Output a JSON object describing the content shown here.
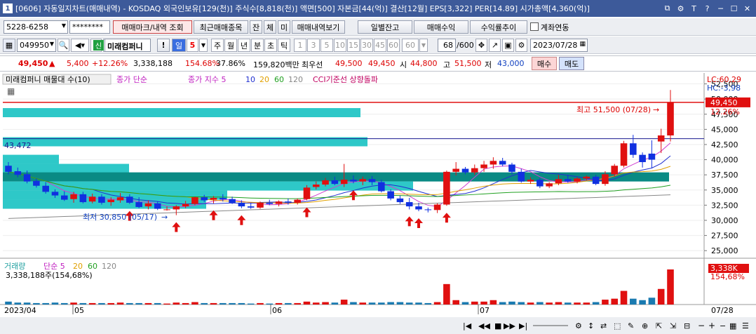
{
  "window": {
    "title": "[0606] 자동일지차트(매매내역) - KOSDAQ 외국인보유[129(천)] 주식수[8,818(천)] 액면[500] 자본금[44(억)] 결산[12월] EPS[3,322] PER[14.89] 시가총액[4,360(억)]",
    "badge": "1",
    "controls": [
      "⧉",
      "⚙",
      "T",
      "?",
      "─",
      "☐",
      "✕"
    ]
  },
  "toolbar1": {
    "account": "5228-6258",
    "password": "********",
    "btn_marks": "매매마크/내역 조회",
    "btn_recent": "최근매매종목",
    "btn_jan": "잔",
    "btn_che": "체",
    "btn_mi": "미",
    "btn_history": "매매내역보기",
    "btn_daily": "일별잔고",
    "btn_profit": "매매수익",
    "btn_rate": "수익률추이",
    "chk_link": "계좌연동"
  },
  "toolbar2": {
    "code": "049950",
    "sin": "신",
    "name": "미래컴퍼니",
    "excl": "!",
    "period_il": "일",
    "period_num": "5",
    "periods": [
      "주",
      "월",
      "년",
      "분",
      "초",
      "틱"
    ],
    "intervals": [
      "1",
      "3",
      "5",
      "10",
      "15",
      "30",
      "45",
      "60",
      "60"
    ],
    "count": "68",
    "count_total": "/600",
    "date": "2023/07/28"
  },
  "quote": {
    "price": "49,450",
    "change": "5,400",
    "pct": "+12.26%",
    "volume": "3,338,188",
    "vol_ratio": "154.68%",
    "turnover": "37.86%",
    "amount": "159,820백만",
    "best": "최우선",
    "ask": "49,500",
    "bid": "49,450",
    "open_label": "시",
    "open": "44,800",
    "high_label": "고",
    "high": "51,500",
    "low_label": "저",
    "low": "43,000",
    "buy": "매수",
    "sell": "매도"
  },
  "legend": {
    "name": "미래컴퍼니 매물대 수(10)",
    "close_simple": "종가 단순",
    "close_exp": "종가 지수 5",
    "ma10": "10",
    "ma20": "20",
    "ma60": "60",
    "ma120": "120",
    "cci": "CCI기준선 상향돌파"
  },
  "volume_legend": {
    "title": "거래량",
    "simple": "단순 5",
    "ma20": "20",
    "ma60": "60",
    "ma120": "120",
    "value": "3,338,188주(154,68%)"
  },
  "annot": {
    "high": "최고 51,500 (07/28)",
    "low": "최저 30,850 (05/17)",
    "hline": "43,472",
    "lc": "LC:60,29",
    "hc": "HC:-3,98",
    "price_tag": "49,450",
    "pct_tag": "12.26%",
    "vol_tag": "3,338K",
    "vol_pct": "154,68%"
  },
  "price_axis": [
    "52,500",
    "50,000",
    "47,500",
    "45,000",
    "42,500",
    "40,000",
    "37,500",
    "35,000",
    "32,500",
    "30,000",
    "27,500",
    "25,000"
  ],
  "date_axis": {
    "start": "2023/04",
    "m05": "05",
    "m06": "06",
    "m07": "07",
    "end": "07/28"
  },
  "colors": {
    "up": "#e01010",
    "down": "#1030e0",
    "hline_red": "#e01010",
    "hline_blue": "#1a1a90",
    "volprofile": "#2ec8c8",
    "volprofile_max": "#0a8a84",
    "ma5": "#d040d0",
    "ma10": "#2030d0",
    "ma20": "#e0a000",
    "ma60": "#20a020",
    "ma120": "#888888"
  },
  "chart_data": {
    "type": "candlestick",
    "ylim": [
      23750,
      54300
    ],
    "candles": [
      [
        39000,
        39600,
        37600,
        38000
      ],
      [
        38100,
        38700,
        37100,
        37500
      ],
      [
        37600,
        38200,
        36100,
        36400
      ],
      [
        36500,
        36900,
        35400,
        35700
      ],
      [
        35700,
        36300,
        34400,
        34700
      ],
      [
        34700,
        35100,
        33700,
        34100
      ],
      [
        34100,
        34800,
        33200,
        33400
      ],
      [
        33500,
        34700,
        32900,
        34300
      ],
      [
        34300,
        34700,
        32800,
        33000
      ],
      [
        33100,
        34400,
        32800,
        33900
      ],
      [
        33900,
        34300,
        32600,
        32900
      ],
      [
        33000,
        33800,
        32400,
        33400
      ],
      [
        33300,
        34500,
        32900,
        33800
      ],
      [
        33900,
        34300,
        32700,
        32900
      ],
      [
        33000,
        33800,
        32000,
        32200
      ],
      [
        32300,
        33300,
        31800,
        32800
      ],
      [
        32800,
        33100,
        31700,
        31900
      ],
      [
        31800,
        32300,
        31600,
        31800
      ],
      [
        31800,
        32500,
        30850,
        32300
      ],
      [
        32300,
        33200,
        32000,
        32700
      ],
      [
        32700,
        33900,
        32500,
        33800
      ],
      [
        33800,
        34200,
        33000,
        33300
      ],
      [
        33400,
        34000,
        32800,
        33700
      ],
      [
        33700,
        34300,
        33100,
        33500
      ],
      [
        33500,
        33900,
        32700,
        32900
      ],
      [
        32900,
        33300,
        32000,
        32300
      ],
      [
        32300,
        32900,
        31900,
        32100
      ],
      [
        32100,
        33100,
        31900,
        32900
      ],
      [
        32900,
        33400,
        32500,
        32700
      ],
      [
        32700,
        33300,
        32300,
        33100
      ],
      [
        33100,
        33600,
        32600,
        32900
      ],
      [
        32900,
        33600,
        32600,
        33400
      ],
      [
        33500,
        35800,
        33300,
        35400
      ],
      [
        35500,
        36400,
        35100,
        35900
      ],
      [
        35900,
        37000,
        35600,
        36600
      ],
      [
        36600,
        37200,
        35800,
        36000
      ],
      [
        36000,
        39300,
        35500,
        36700
      ],
      [
        36700,
        37400,
        36100,
        36400
      ],
      [
        36400,
        37200,
        35800,
        36800
      ],
      [
        36800,
        37300,
        35800,
        36300
      ],
      [
        36300,
        36700,
        34600,
        34800
      ],
      [
        34800,
        35100,
        33300,
        33600
      ],
      [
        33600,
        34100,
        32700,
        33000
      ],
      [
        33000,
        33700,
        31800,
        32300
      ],
      [
        32300,
        32900,
        31500,
        31800
      ],
      [
        31800,
        32100,
        31300,
        31700
      ],
      [
        31700,
        32800,
        31200,
        32600
      ],
      [
        32600,
        38200,
        32400,
        38000
      ],
      [
        38000,
        39600,
        37400,
        38500
      ],
      [
        38500,
        38800,
        37600,
        37900
      ],
      [
        37900,
        39200,
        37500,
        38600
      ],
      [
        38600,
        39800,
        38000,
        39200
      ],
      [
        39200,
        40400,
        38500,
        39800
      ],
      [
        39800,
        40300,
        38900,
        39200
      ],
      [
        39200,
        39500,
        37600,
        38000
      ],
      [
        38000,
        38500,
        36200,
        36400
      ],
      [
        36400,
        37100,
        36000,
        36700
      ],
      [
        36700,
        37000,
        35300,
        35600
      ],
      [
        35600,
        36300,
        35300,
        36100
      ],
      [
        36100,
        37500,
        35800,
        36800
      ],
      [
        36800,
        37500,
        36200,
        36400
      ],
      [
        36400,
        37100,
        36100,
        36900
      ],
      [
        36900,
        37400,
        36600,
        37200
      ],
      [
        37200,
        37500,
        35800,
        36000
      ],
      [
        36000,
        38100,
        35700,
        37600
      ],
      [
        37600,
        39300,
        37200,
        39000
      ],
      [
        39000,
        43100,
        38700,
        42700
      ],
      [
        42700,
        44100,
        40300,
        40800
      ],
      [
        40800,
        41200,
        38700,
        39600
      ],
      [
        41000,
        43200,
        38600,
        40000
      ],
      [
        43000,
        45100,
        41100,
        44000
      ],
      [
        44000,
        51500,
        43000,
        49450
      ]
    ],
    "volume": [
      6,
      4,
      4,
      3,
      3,
      4,
      3,
      4,
      3,
      3,
      3,
      3,
      4,
      3,
      3,
      3,
      3,
      2,
      4,
      3,
      5,
      3,
      3,
      3,
      3,
      3,
      2,
      3,
      2,
      3,
      3,
      3,
      6,
      4,
      5,
      4,
      10,
      5,
      4,
      4,
      4,
      5,
      5,
      4,
      4,
      3,
      5,
      42,
      9,
      5,
      6,
      6,
      9,
      5,
      6,
      5,
      4,
      5,
      4,
      5,
      4,
      4,
      4,
      5,
      10,
      12,
      28,
      12,
      9,
      14,
      32,
      72
    ],
    "volume_unit": "relative",
    "high_marker": {
      "value": 51500,
      "date": "07/28"
    },
    "low_marker": {
      "value": 30850,
      "date": "05/17"
    },
    "hlines": [
      49450,
      43472
    ],
    "volume_profile": [
      {
        "price": 47700,
        "w": 510
      },
      {
        "price": 42900,
        "w": 520
      },
      {
        "price": 40000,
        "w": 80
      },
      {
        "price": 38500,
        "w": 180
      },
      {
        "price": 37100,
        "w": 950,
        "max": true
      },
      {
        "price": 35600,
        "w": 585
      },
      {
        "price": 34100,
        "w": 320
      },
      {
        "price": 32600,
        "w": 290
      }
    ],
    "buy_markers": [
      13,
      18,
      22,
      25,
      32,
      37,
      43,
      44,
      47
    ]
  }
}
